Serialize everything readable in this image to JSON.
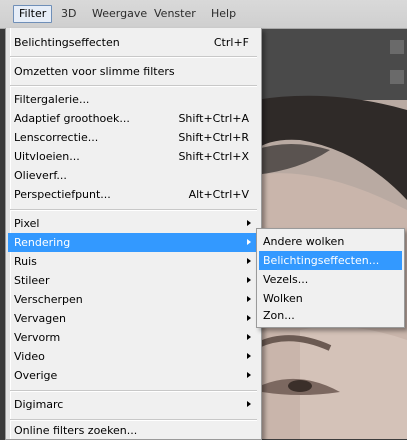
{
  "menubar": {
    "items": [
      "Filter",
      "3D",
      "Weergave",
      "Venster",
      "Help"
    ],
    "active_index": 0
  },
  "filter_menu": {
    "items": [
      {
        "label": "Belichtingseffecten",
        "shortcut": "Ctrl+F"
      },
      {
        "label": "Omzetten voor slimme filters",
        "shortcut": ""
      },
      {
        "label": "Filtergalerie...",
        "shortcut": ""
      },
      {
        "label": "Adaptief groothoek...",
        "shortcut": "Shift+Ctrl+A"
      },
      {
        "label": "Lenscorrectie...",
        "shortcut": "Shift+Ctrl+R"
      },
      {
        "label": "Uitvloeien...",
        "shortcut": "Shift+Ctrl+X"
      },
      {
        "label": "Olieverf...",
        "shortcut": ""
      },
      {
        "label": "Perspectiefpunt...",
        "shortcut": "Alt+Ctrl+V"
      },
      {
        "label": "Pixel",
        "submenu": true
      },
      {
        "label": "Rendering",
        "submenu": true,
        "highlighted": true
      },
      {
        "label": "Ruis",
        "submenu": true
      },
      {
        "label": "Stileer",
        "submenu": true
      },
      {
        "label": "Verscherpen",
        "submenu": true
      },
      {
        "label": "Vervagen",
        "submenu": true
      },
      {
        "label": "Vervorm",
        "submenu": true
      },
      {
        "label": "Video",
        "submenu": true
      },
      {
        "label": "Overige",
        "submenu": true
      },
      {
        "label": "Digimarc",
        "submenu": true
      },
      {
        "label": "Online filters zoeken..."
      }
    ]
  },
  "rendering_submenu": {
    "items": [
      {
        "label": "Andere wolken"
      },
      {
        "label": "Belichtingseffecten...",
        "highlighted": true
      },
      {
        "label": "Vezels..."
      },
      {
        "label": "Wolken"
      },
      {
        "label": "Zon..."
      }
    ]
  },
  "colors": {
    "highlight": "#3399ff",
    "menu_bg": "#f0f0f0",
    "menubar_bg": "#d6d6d6"
  }
}
